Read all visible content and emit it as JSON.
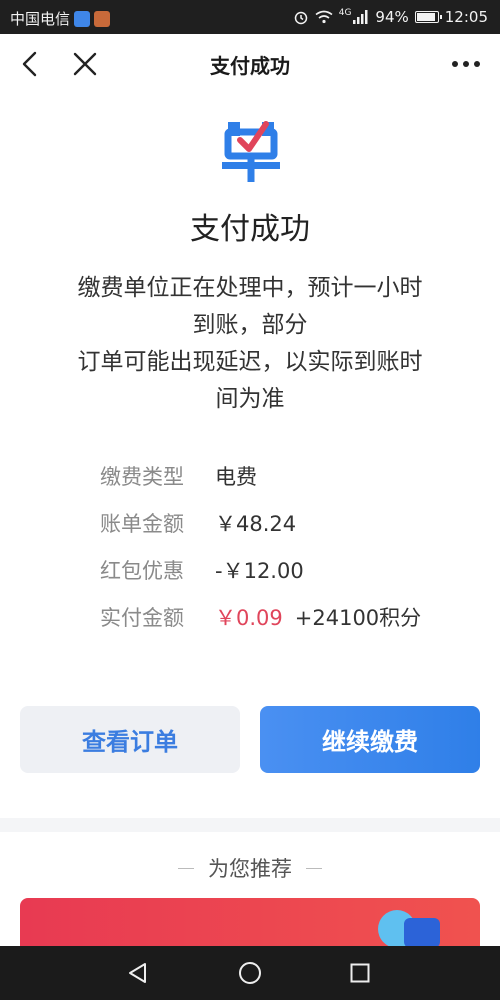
{
  "status_bar": {
    "carrier": "中国电信",
    "network": "4G",
    "battery_percent": "94%",
    "battery_level": 0.94,
    "time": "12:05"
  },
  "nav": {
    "title": "支付成功",
    "back_icon": "chevron-left-icon",
    "close_icon": "close-icon",
    "more_icon": "more-dots-icon"
  },
  "result": {
    "logo_icon": "bill-logo-icon",
    "title": "支付成功",
    "notice_lines": [
      "缴费单位正在处理中，预计一小时",
      "到账，部分",
      "订单可能出现延迟，以实际到账时",
      "间为准"
    ]
  },
  "details": [
    {
      "label": "缴费类型",
      "value": "电费"
    },
    {
      "label": "账单金额",
      "value": "￥48.24"
    },
    {
      "label": "红包优惠",
      "value": "-￥12.00"
    },
    {
      "label": "实付金额",
      "value": "￥0.09",
      "extra": "+24100积分"
    }
  ],
  "buttons": {
    "view_order": "查看订单",
    "continue_pay": "继续缴费"
  },
  "recommend": {
    "title": "为您推荐"
  },
  "colors": {
    "accent_blue": "#3b7de0",
    "price_red": "#e0455b",
    "banner_red": "#e83a52"
  }
}
